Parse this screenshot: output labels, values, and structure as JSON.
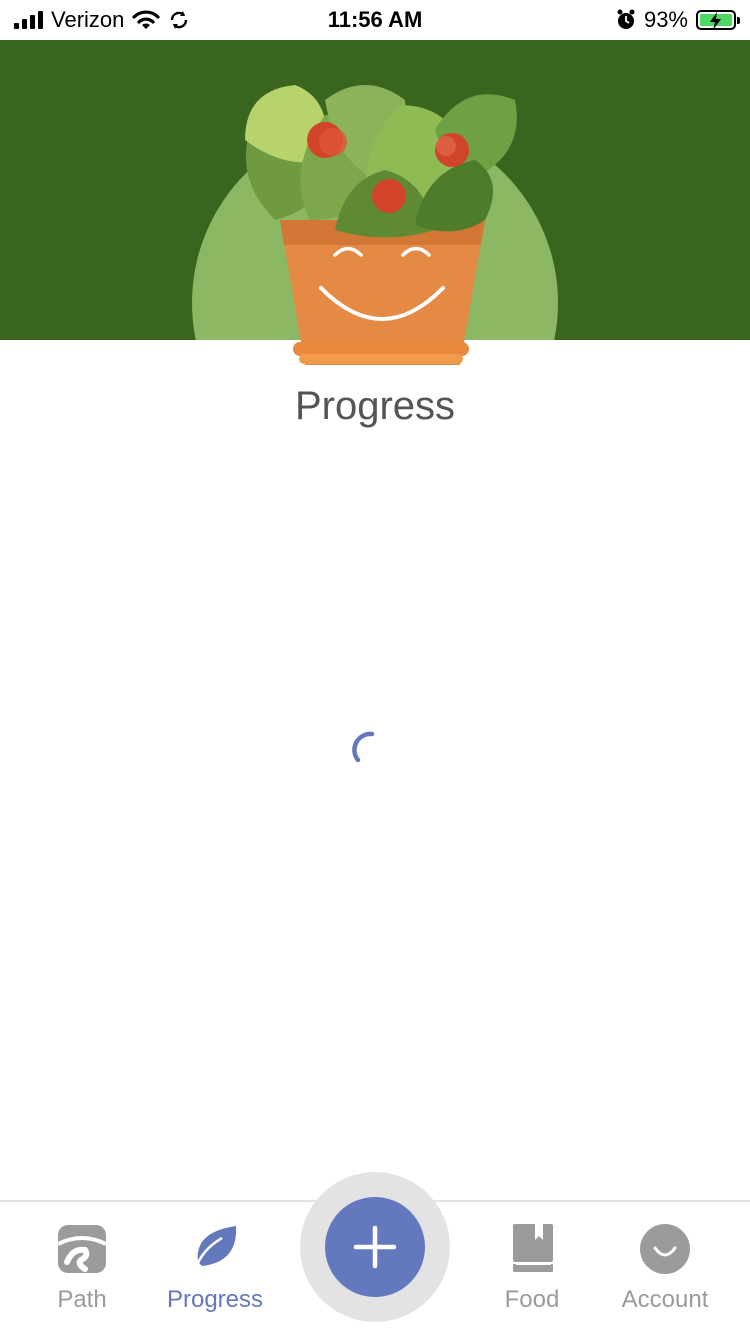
{
  "status_bar": {
    "carrier": "Verizon",
    "time": "11:56 AM",
    "battery_percent": "93%",
    "icons": [
      "signal-icon",
      "wifi-icon",
      "sync-icon",
      "alarm-icon",
      "battery-charging-icon"
    ]
  },
  "header": {
    "illustration": "smiling-potted-plant",
    "colors": {
      "background": "#3a651e",
      "circle": "#8cb864"
    }
  },
  "main": {
    "title": "Progress",
    "loading": true,
    "spinner_color": "#6378bd"
  },
  "tab_bar": {
    "tabs": [
      {
        "label": "Path",
        "icon": "path-icon",
        "active": false
      },
      {
        "label": "Progress",
        "icon": "leaf-icon",
        "active": true
      },
      {
        "label": "Food",
        "icon": "book-icon",
        "active": false
      },
      {
        "label": "Account",
        "icon": "account-icon",
        "active": false
      }
    ],
    "add_button_icon": "plus-icon",
    "colors": {
      "active": "#6378bd",
      "inactive": "#9b9b9b"
    }
  }
}
